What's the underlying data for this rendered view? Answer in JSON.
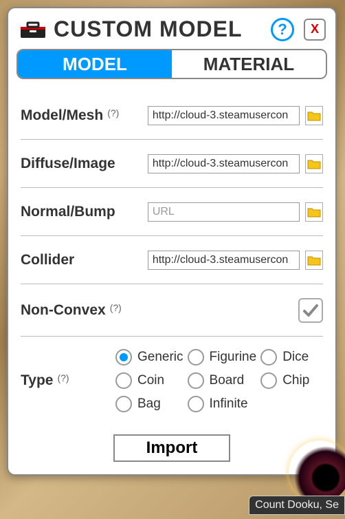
{
  "window": {
    "title": "CUSTOM MODEL",
    "help_symbol": "?",
    "close_symbol": "X"
  },
  "tabs": {
    "model": "MODEL",
    "material": "MATERIAL",
    "active": "model"
  },
  "fields": {
    "mesh": {
      "label": "Model/Mesh",
      "hint": "(?)",
      "value": "http://cloud-3.steamusercon"
    },
    "diffuse": {
      "label": "Diffuse/Image",
      "value": "http://cloud-3.steamusercon"
    },
    "normal": {
      "label": "Normal/Bump",
      "placeholder": "URL",
      "value": ""
    },
    "collider": {
      "label": "Collider",
      "value": "http://cloud-3.steamusercon"
    },
    "nonconvex": {
      "label": "Non-Convex",
      "hint": "(?)",
      "checked": true
    },
    "type": {
      "label": "Type",
      "hint": "(?)",
      "selected": "Generic",
      "options": [
        "Generic",
        "Figurine",
        "Dice",
        "Coin",
        "Board",
        "Chip",
        "Bag",
        "Infinite"
      ]
    }
  },
  "buttons": {
    "import": "Import"
  },
  "tooltip": "Count Dooku, Se"
}
